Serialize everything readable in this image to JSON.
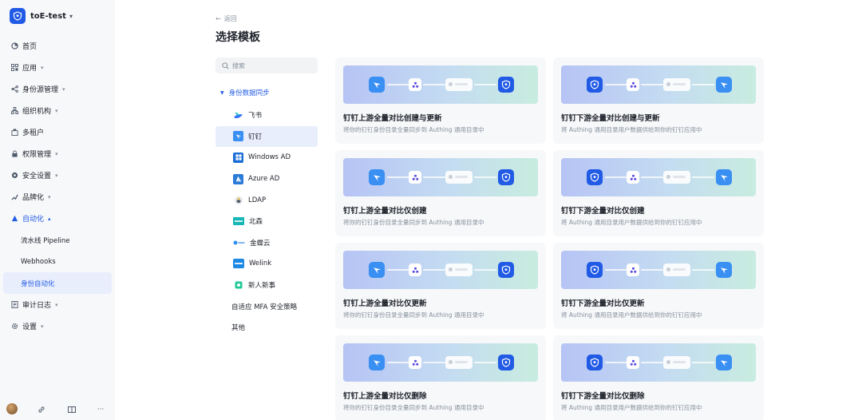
{
  "org": {
    "name": "toE-test"
  },
  "nav": {
    "items": [
      {
        "label": "首页",
        "icon": "home-icon",
        "caret": false
      },
      {
        "label": "应用",
        "icon": "apps-icon",
        "caret": true
      },
      {
        "label": "身份源管理",
        "icon": "identity-source-icon",
        "caret": true
      },
      {
        "label": "组织机构",
        "icon": "org-icon",
        "caret": true
      },
      {
        "label": "多租户",
        "icon": "tenant-icon",
        "caret": false
      },
      {
        "label": "权限管理",
        "icon": "permission-icon",
        "caret": true
      },
      {
        "label": "安全设置",
        "icon": "security-icon",
        "caret": true
      },
      {
        "label": "品牌化",
        "icon": "brand-icon",
        "caret": true
      },
      {
        "label": "自动化",
        "icon": "automation-icon",
        "caret": true,
        "open": true
      }
    ],
    "automation_sub": [
      {
        "label": "流水线 Pipeline"
      },
      {
        "label": "Webhooks"
      },
      {
        "label": "身份自动化",
        "active": true
      }
    ],
    "after": [
      {
        "label": "审计日志",
        "icon": "audit-log-icon",
        "caret": true
      },
      {
        "label": "设置",
        "icon": "settings-icon",
        "caret": true
      }
    ]
  },
  "header": {
    "back_label": "返回",
    "title": "选择模板"
  },
  "search": {
    "placeholder": "搜索"
  },
  "categories": {
    "group_label": "身份数据同步",
    "items": [
      {
        "label": "飞书",
        "icon": "feishu-icon",
        "color": "#3370ff"
      },
      {
        "label": "钉钉",
        "icon": "dingtalk-icon",
        "color": "#3a8ff3",
        "active": true
      },
      {
        "label": "Windows AD",
        "icon": "windows-icon",
        "color": "#1a6fd6"
      },
      {
        "label": "Azure AD",
        "icon": "azure-icon",
        "color": "#2b7bd9"
      },
      {
        "label": "LDAP",
        "icon": "ldap-icon",
        "color": "#c9cdd4"
      },
      {
        "label": "北森",
        "icon": "beisen-icon",
        "color": "#16b6b6"
      },
      {
        "label": "金蝶云",
        "icon": "kingdee-icon",
        "color": "#2f8ff0"
      },
      {
        "label": "Welink",
        "icon": "welink-icon",
        "color": "#1e88e5"
      },
      {
        "label": "新人新事",
        "icon": "xinrenxinshi-icon",
        "color": "#20c997"
      }
    ],
    "others": [
      {
        "label": "自适应 MFA 安全策略"
      },
      {
        "label": "其他"
      }
    ]
  },
  "templates": [
    {
      "title": "钉钉上游全量对比创建与更新",
      "desc": "将你的钉钉身份目录全量同步到 Authing 通用目录中",
      "direction": "upstream"
    },
    {
      "title": "钉钉下游全量对比创建与更新",
      "desc": "将 Authing 通用目录用户数据供给到你的钉钉应用中",
      "direction": "downstream"
    },
    {
      "title": "钉钉上游全量对比仅创建",
      "desc": "将你的钉钉身份目录全量同步到 Authing 通用目录中",
      "direction": "upstream"
    },
    {
      "title": "钉钉下游全量对比仅创建",
      "desc": "将 Authing 通用目录用户数据供给到你的钉钉应用中",
      "direction": "downstream"
    },
    {
      "title": "钉钉上游全量对比仅更新",
      "desc": "将你的钉钉身份目录全量同步到 Authing 通用目录中",
      "direction": "upstream"
    },
    {
      "title": "钉钉下游全量对比仅更新",
      "desc": "将 Authing 通用目录用户数据供给到你的钉钉应用中",
      "direction": "downstream"
    },
    {
      "title": "钉钉上游全量对比仅删除",
      "desc": "将你的钉钉身份目录全量同步到 Authing 通用目录中",
      "direction": "upstream"
    },
    {
      "title": "钉钉下游全量对比仅删除",
      "desc": "将 Authing 通用目录用户数据供给到你的钉钉应用中",
      "direction": "downstream"
    }
  ],
  "colors": {
    "accent": "#215ae5",
    "dingtalk": "#3a8ff3",
    "sidebar_bg": "#f7f8fa"
  }
}
